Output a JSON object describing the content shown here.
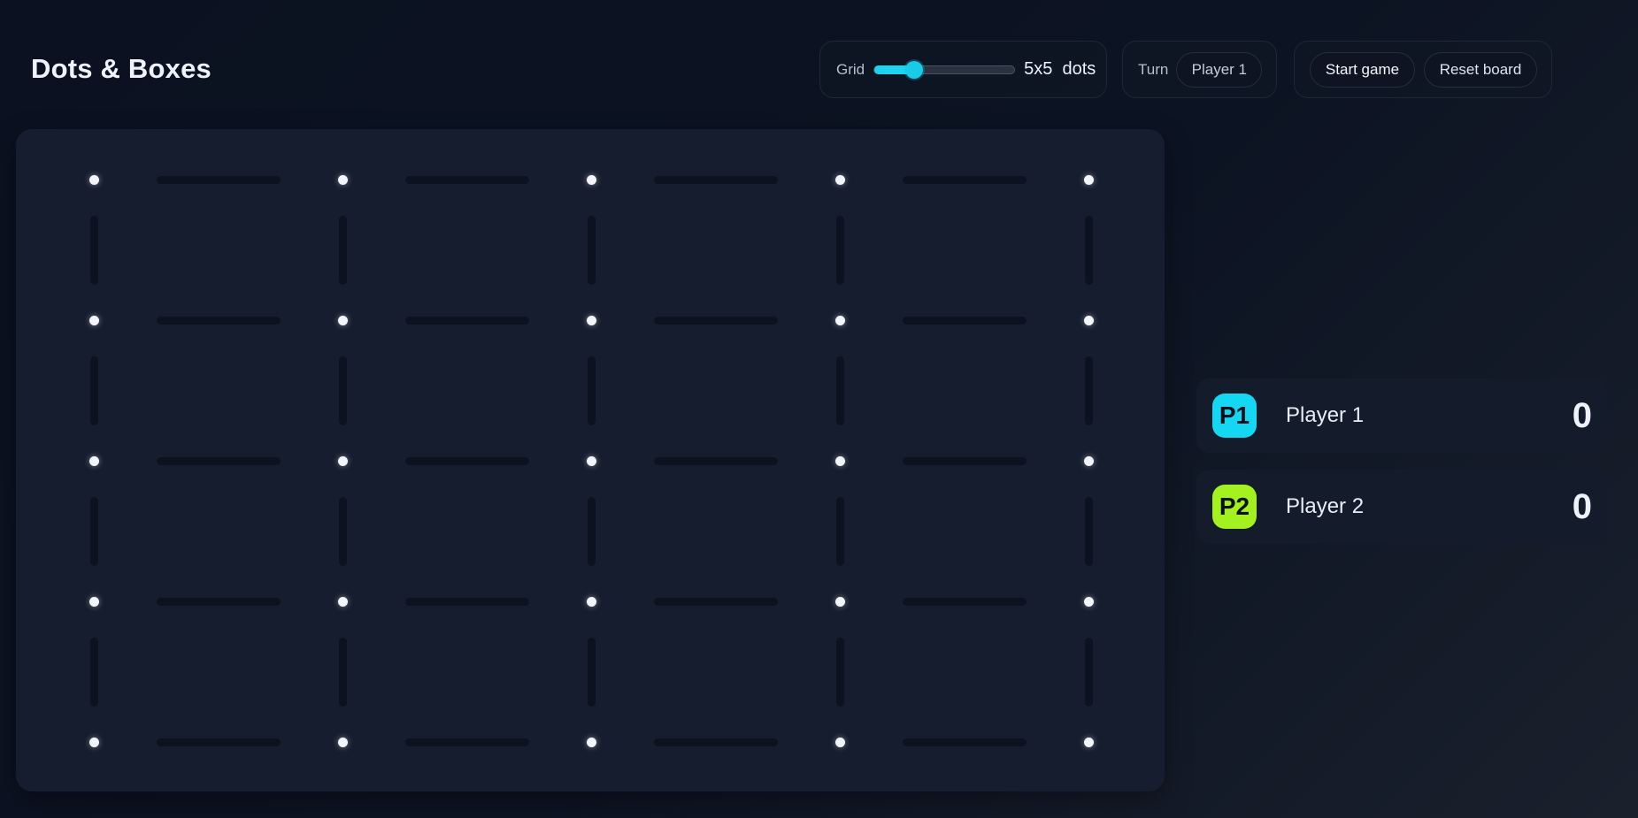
{
  "app": {
    "title": "Dots & Boxes"
  },
  "controls": {
    "grid_label": "Grid",
    "grid_size_value": "5x5",
    "grid_size_unit": "dots",
    "grid_slider_level": 0.25,
    "turn_label": "Turn",
    "turn_value": "Player 1",
    "start_button": "Start game",
    "reset_button": "Reset board"
  },
  "board": {
    "dots_per_side": 5,
    "lines_drawn": 0
  },
  "players": [
    {
      "badge": "P1",
      "name": "Player 1",
      "score": "0",
      "color": "#14d8f2"
    },
    {
      "badge": "P2",
      "name": "Player 2",
      "score": "0",
      "color": "#a3f21f"
    }
  ],
  "colors": {
    "accent": "#1fd3f0",
    "background": "#0b1120",
    "board": "#161d2e",
    "dot": "#f2f5fb",
    "empty_line": "#0c1220"
  }
}
